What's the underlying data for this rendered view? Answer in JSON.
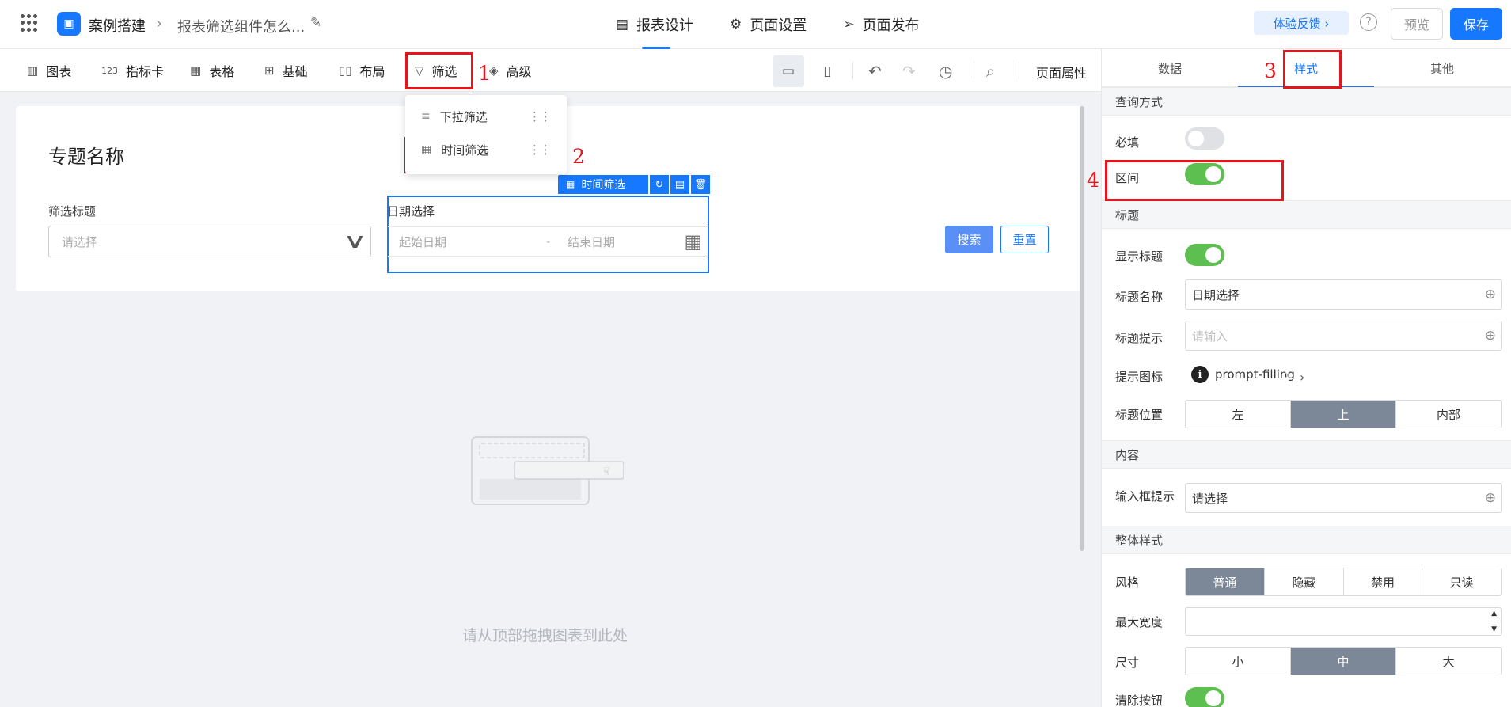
{
  "header": {
    "app_name": "案例搭建",
    "breadcrumb_sep": "›",
    "page_name": "报表筛选组件怎么...",
    "tabs": [
      {
        "label": "报表设计",
        "icon": "report-icon"
      },
      {
        "label": "页面设置",
        "icon": "gear-icon"
      },
      {
        "label": "页面发布",
        "icon": "send-icon"
      }
    ],
    "active_tab": "报表设计",
    "feedback": "体验反馈 ›",
    "help": "?",
    "preview": "预览",
    "save": "保存",
    "brand_color": "#1677ff"
  },
  "toolbar": {
    "items": [
      {
        "label": "图表",
        "icon": "bar-chart-icon"
      },
      {
        "label": "指标卡",
        "icon": "123-icon"
      },
      {
        "label": "表格",
        "icon": "table-icon"
      },
      {
        "label": "基础",
        "icon": "grid-icon"
      },
      {
        "label": "布局",
        "icon": "layout-icon"
      },
      {
        "label": "筛选",
        "icon": "filter-icon"
      },
      {
        "label": "高级",
        "icon": "layers-icon"
      }
    ],
    "page_props": "页面属性"
  },
  "filter_menu": {
    "items": [
      {
        "label": "下拉筛选",
        "icon": "dropdown-filter-icon"
      },
      {
        "label": "时间筛选",
        "icon": "calendar-icon"
      }
    ]
  },
  "canvas": {
    "card_title": "专题名称",
    "filter1": {
      "label": "筛选标题",
      "placeholder": "请选择"
    },
    "selected_component": "时间筛选",
    "filter2": {
      "label": "日期选择",
      "start_placeholder": "起始日期",
      "dash": "-",
      "end_placeholder": "结束日期"
    },
    "search_button": "搜索",
    "reset_button": "重置",
    "drop_hint": "请从顶部拖拽图表到此处"
  },
  "panel": {
    "tabs": [
      "数据",
      "样式",
      "其他"
    ],
    "active_tab": "样式",
    "sections": {
      "query_mode": "查询方式",
      "title": "标题",
      "content": "内容",
      "overall_style": "整体样式"
    },
    "fields": {
      "required": {
        "label": "必填",
        "on": false
      },
      "range": {
        "label": "区间",
        "on": true
      },
      "show_title": {
        "label": "显示标题",
        "on": true
      },
      "title_name": {
        "label": "标题名称",
        "value": "日期选择"
      },
      "title_tip": {
        "label": "标题提示",
        "placeholder": "请输入"
      },
      "tip_icon": {
        "label": "提示图标",
        "value": "prompt-filling",
        "clear": "×",
        "arrow": "›"
      },
      "title_position": {
        "label": "标题位置",
        "options": [
          "左",
          "上",
          "内部"
        ],
        "selected": "上"
      },
      "input_hint": {
        "label": "输入框提示",
        "value": "请选择"
      },
      "style": {
        "label": "风格",
        "options": [
          "普通",
          "隐藏",
          "禁用",
          "只读"
        ],
        "selected": "普通"
      },
      "max_width": {
        "label": "最大宽度",
        "value": ""
      },
      "size": {
        "label": "尺寸",
        "options": [
          "小",
          "中",
          "大"
        ],
        "selected": "中"
      },
      "clear_button": {
        "label": "清除按钮",
        "on": true
      }
    }
  },
  "annotations": [
    "1",
    "2",
    "3",
    "4"
  ]
}
